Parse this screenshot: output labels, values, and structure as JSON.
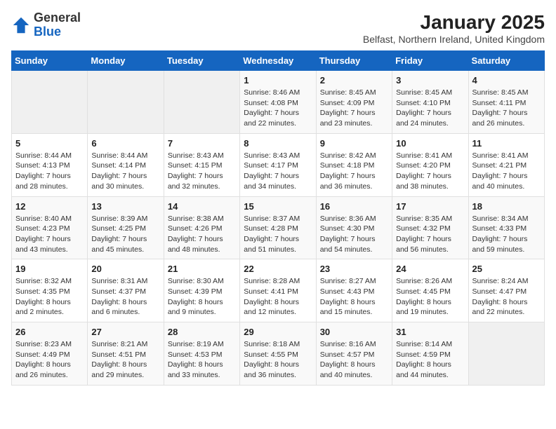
{
  "logo": {
    "general": "General",
    "blue": "Blue"
  },
  "title": "January 2025",
  "location": "Belfast, Northern Ireland, United Kingdom",
  "days_of_week": [
    "Sunday",
    "Monday",
    "Tuesday",
    "Wednesday",
    "Thursday",
    "Friday",
    "Saturday"
  ],
  "weeks": [
    [
      {
        "day": "",
        "info": ""
      },
      {
        "day": "",
        "info": ""
      },
      {
        "day": "",
        "info": ""
      },
      {
        "day": "1",
        "info": "Sunrise: 8:46 AM\nSunset: 4:08 PM\nDaylight: 7 hours\nand 22 minutes."
      },
      {
        "day": "2",
        "info": "Sunrise: 8:45 AM\nSunset: 4:09 PM\nDaylight: 7 hours\nand 23 minutes."
      },
      {
        "day": "3",
        "info": "Sunrise: 8:45 AM\nSunset: 4:10 PM\nDaylight: 7 hours\nand 24 minutes."
      },
      {
        "day": "4",
        "info": "Sunrise: 8:45 AM\nSunset: 4:11 PM\nDaylight: 7 hours\nand 26 minutes."
      }
    ],
    [
      {
        "day": "5",
        "info": "Sunrise: 8:44 AM\nSunset: 4:13 PM\nDaylight: 7 hours\nand 28 minutes."
      },
      {
        "day": "6",
        "info": "Sunrise: 8:44 AM\nSunset: 4:14 PM\nDaylight: 7 hours\nand 30 minutes."
      },
      {
        "day": "7",
        "info": "Sunrise: 8:43 AM\nSunset: 4:15 PM\nDaylight: 7 hours\nand 32 minutes."
      },
      {
        "day": "8",
        "info": "Sunrise: 8:43 AM\nSunset: 4:17 PM\nDaylight: 7 hours\nand 34 minutes."
      },
      {
        "day": "9",
        "info": "Sunrise: 8:42 AM\nSunset: 4:18 PM\nDaylight: 7 hours\nand 36 minutes."
      },
      {
        "day": "10",
        "info": "Sunrise: 8:41 AM\nSunset: 4:20 PM\nDaylight: 7 hours\nand 38 minutes."
      },
      {
        "day": "11",
        "info": "Sunrise: 8:41 AM\nSunset: 4:21 PM\nDaylight: 7 hours\nand 40 minutes."
      }
    ],
    [
      {
        "day": "12",
        "info": "Sunrise: 8:40 AM\nSunset: 4:23 PM\nDaylight: 7 hours\nand 43 minutes."
      },
      {
        "day": "13",
        "info": "Sunrise: 8:39 AM\nSunset: 4:25 PM\nDaylight: 7 hours\nand 45 minutes."
      },
      {
        "day": "14",
        "info": "Sunrise: 8:38 AM\nSunset: 4:26 PM\nDaylight: 7 hours\nand 48 minutes."
      },
      {
        "day": "15",
        "info": "Sunrise: 8:37 AM\nSunset: 4:28 PM\nDaylight: 7 hours\nand 51 minutes."
      },
      {
        "day": "16",
        "info": "Sunrise: 8:36 AM\nSunset: 4:30 PM\nDaylight: 7 hours\nand 54 minutes."
      },
      {
        "day": "17",
        "info": "Sunrise: 8:35 AM\nSunset: 4:32 PM\nDaylight: 7 hours\nand 56 minutes."
      },
      {
        "day": "18",
        "info": "Sunrise: 8:34 AM\nSunset: 4:33 PM\nDaylight: 7 hours\nand 59 minutes."
      }
    ],
    [
      {
        "day": "19",
        "info": "Sunrise: 8:32 AM\nSunset: 4:35 PM\nDaylight: 8 hours\nand 2 minutes."
      },
      {
        "day": "20",
        "info": "Sunrise: 8:31 AM\nSunset: 4:37 PM\nDaylight: 8 hours\nand 6 minutes."
      },
      {
        "day": "21",
        "info": "Sunrise: 8:30 AM\nSunset: 4:39 PM\nDaylight: 8 hours\nand 9 minutes."
      },
      {
        "day": "22",
        "info": "Sunrise: 8:28 AM\nSunset: 4:41 PM\nDaylight: 8 hours\nand 12 minutes."
      },
      {
        "day": "23",
        "info": "Sunrise: 8:27 AM\nSunset: 4:43 PM\nDaylight: 8 hours\nand 15 minutes."
      },
      {
        "day": "24",
        "info": "Sunrise: 8:26 AM\nSunset: 4:45 PM\nDaylight: 8 hours\nand 19 minutes."
      },
      {
        "day": "25",
        "info": "Sunrise: 8:24 AM\nSunset: 4:47 PM\nDaylight: 8 hours\nand 22 minutes."
      }
    ],
    [
      {
        "day": "26",
        "info": "Sunrise: 8:23 AM\nSunset: 4:49 PM\nDaylight: 8 hours\nand 26 minutes."
      },
      {
        "day": "27",
        "info": "Sunrise: 8:21 AM\nSunset: 4:51 PM\nDaylight: 8 hours\nand 29 minutes."
      },
      {
        "day": "28",
        "info": "Sunrise: 8:19 AM\nSunset: 4:53 PM\nDaylight: 8 hours\nand 33 minutes."
      },
      {
        "day": "29",
        "info": "Sunrise: 8:18 AM\nSunset: 4:55 PM\nDaylight: 8 hours\nand 36 minutes."
      },
      {
        "day": "30",
        "info": "Sunrise: 8:16 AM\nSunset: 4:57 PM\nDaylight: 8 hours\nand 40 minutes."
      },
      {
        "day": "31",
        "info": "Sunrise: 8:14 AM\nSunset: 4:59 PM\nDaylight: 8 hours\nand 44 minutes."
      },
      {
        "day": "",
        "info": ""
      }
    ]
  ]
}
